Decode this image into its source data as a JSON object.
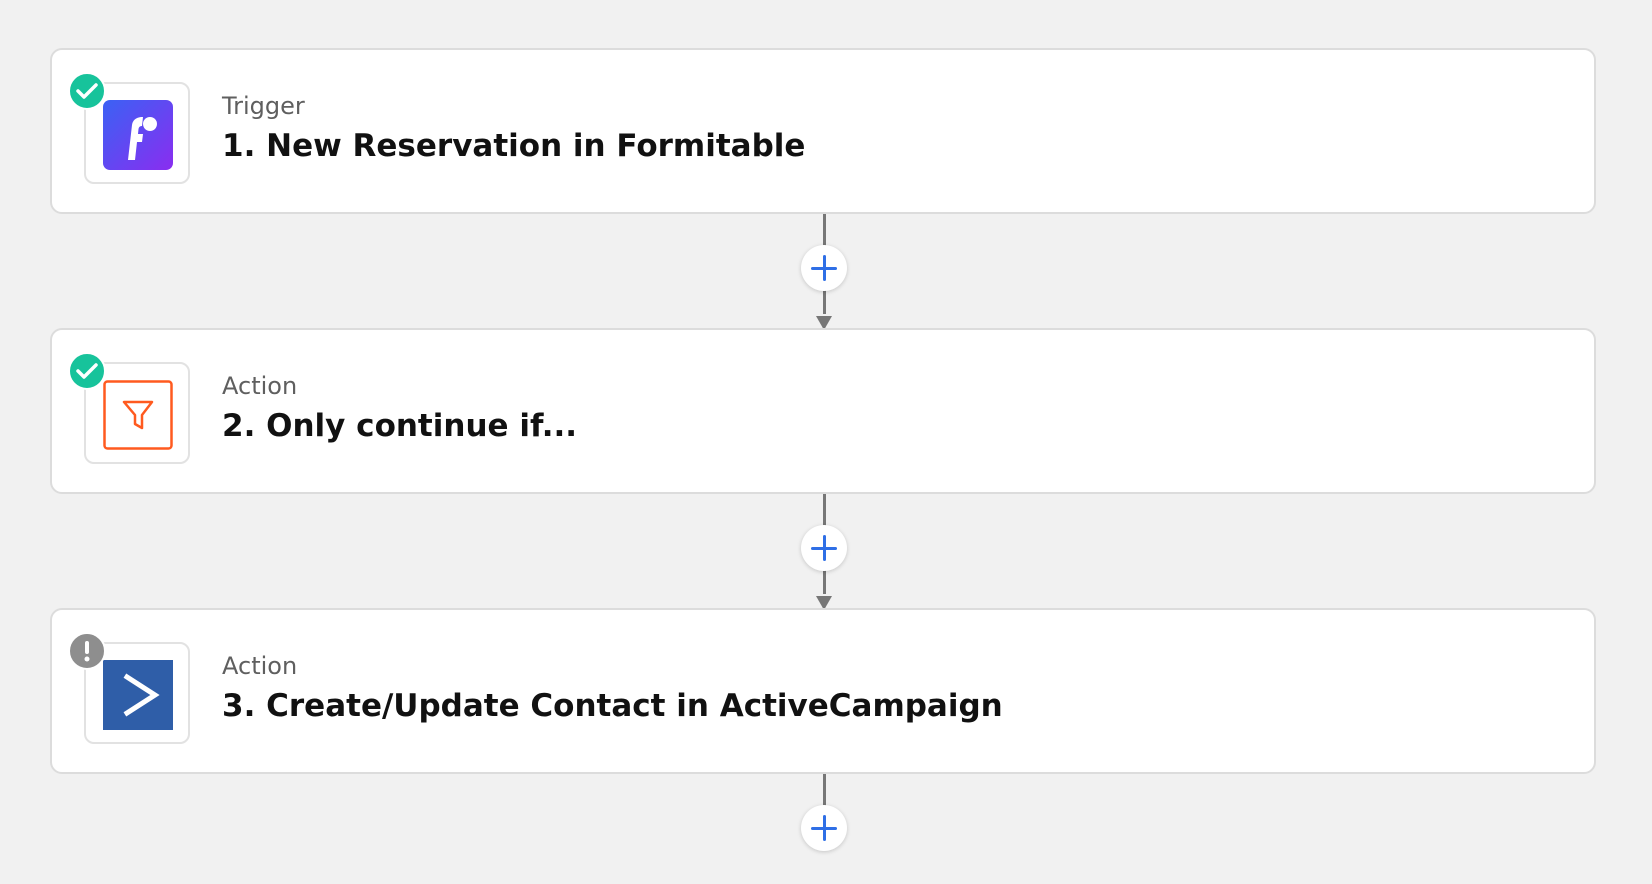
{
  "steps": [
    {
      "type_label": "Trigger",
      "title": "1. New Reservation in Formitable",
      "status": "complete",
      "app_icon": "formitable-icon",
      "app_color": "#6d3ef2"
    },
    {
      "type_label": "Action",
      "title": "2. Only continue if...",
      "status": "complete",
      "app_icon": "filter-icon",
      "app_color": "#ff5a1f"
    },
    {
      "type_label": "Action",
      "title": "3. Create/Update Contact in ActiveCampaign",
      "status": "needs-attention",
      "app_icon": "activecampaign-icon",
      "app_color": "#2f5ea8"
    }
  ],
  "status_colors": {
    "complete": "#17c39b",
    "needs_attention": "#8e8e8e"
  },
  "accent_color": "#2f6fe6",
  "add_step_buttons": 3
}
